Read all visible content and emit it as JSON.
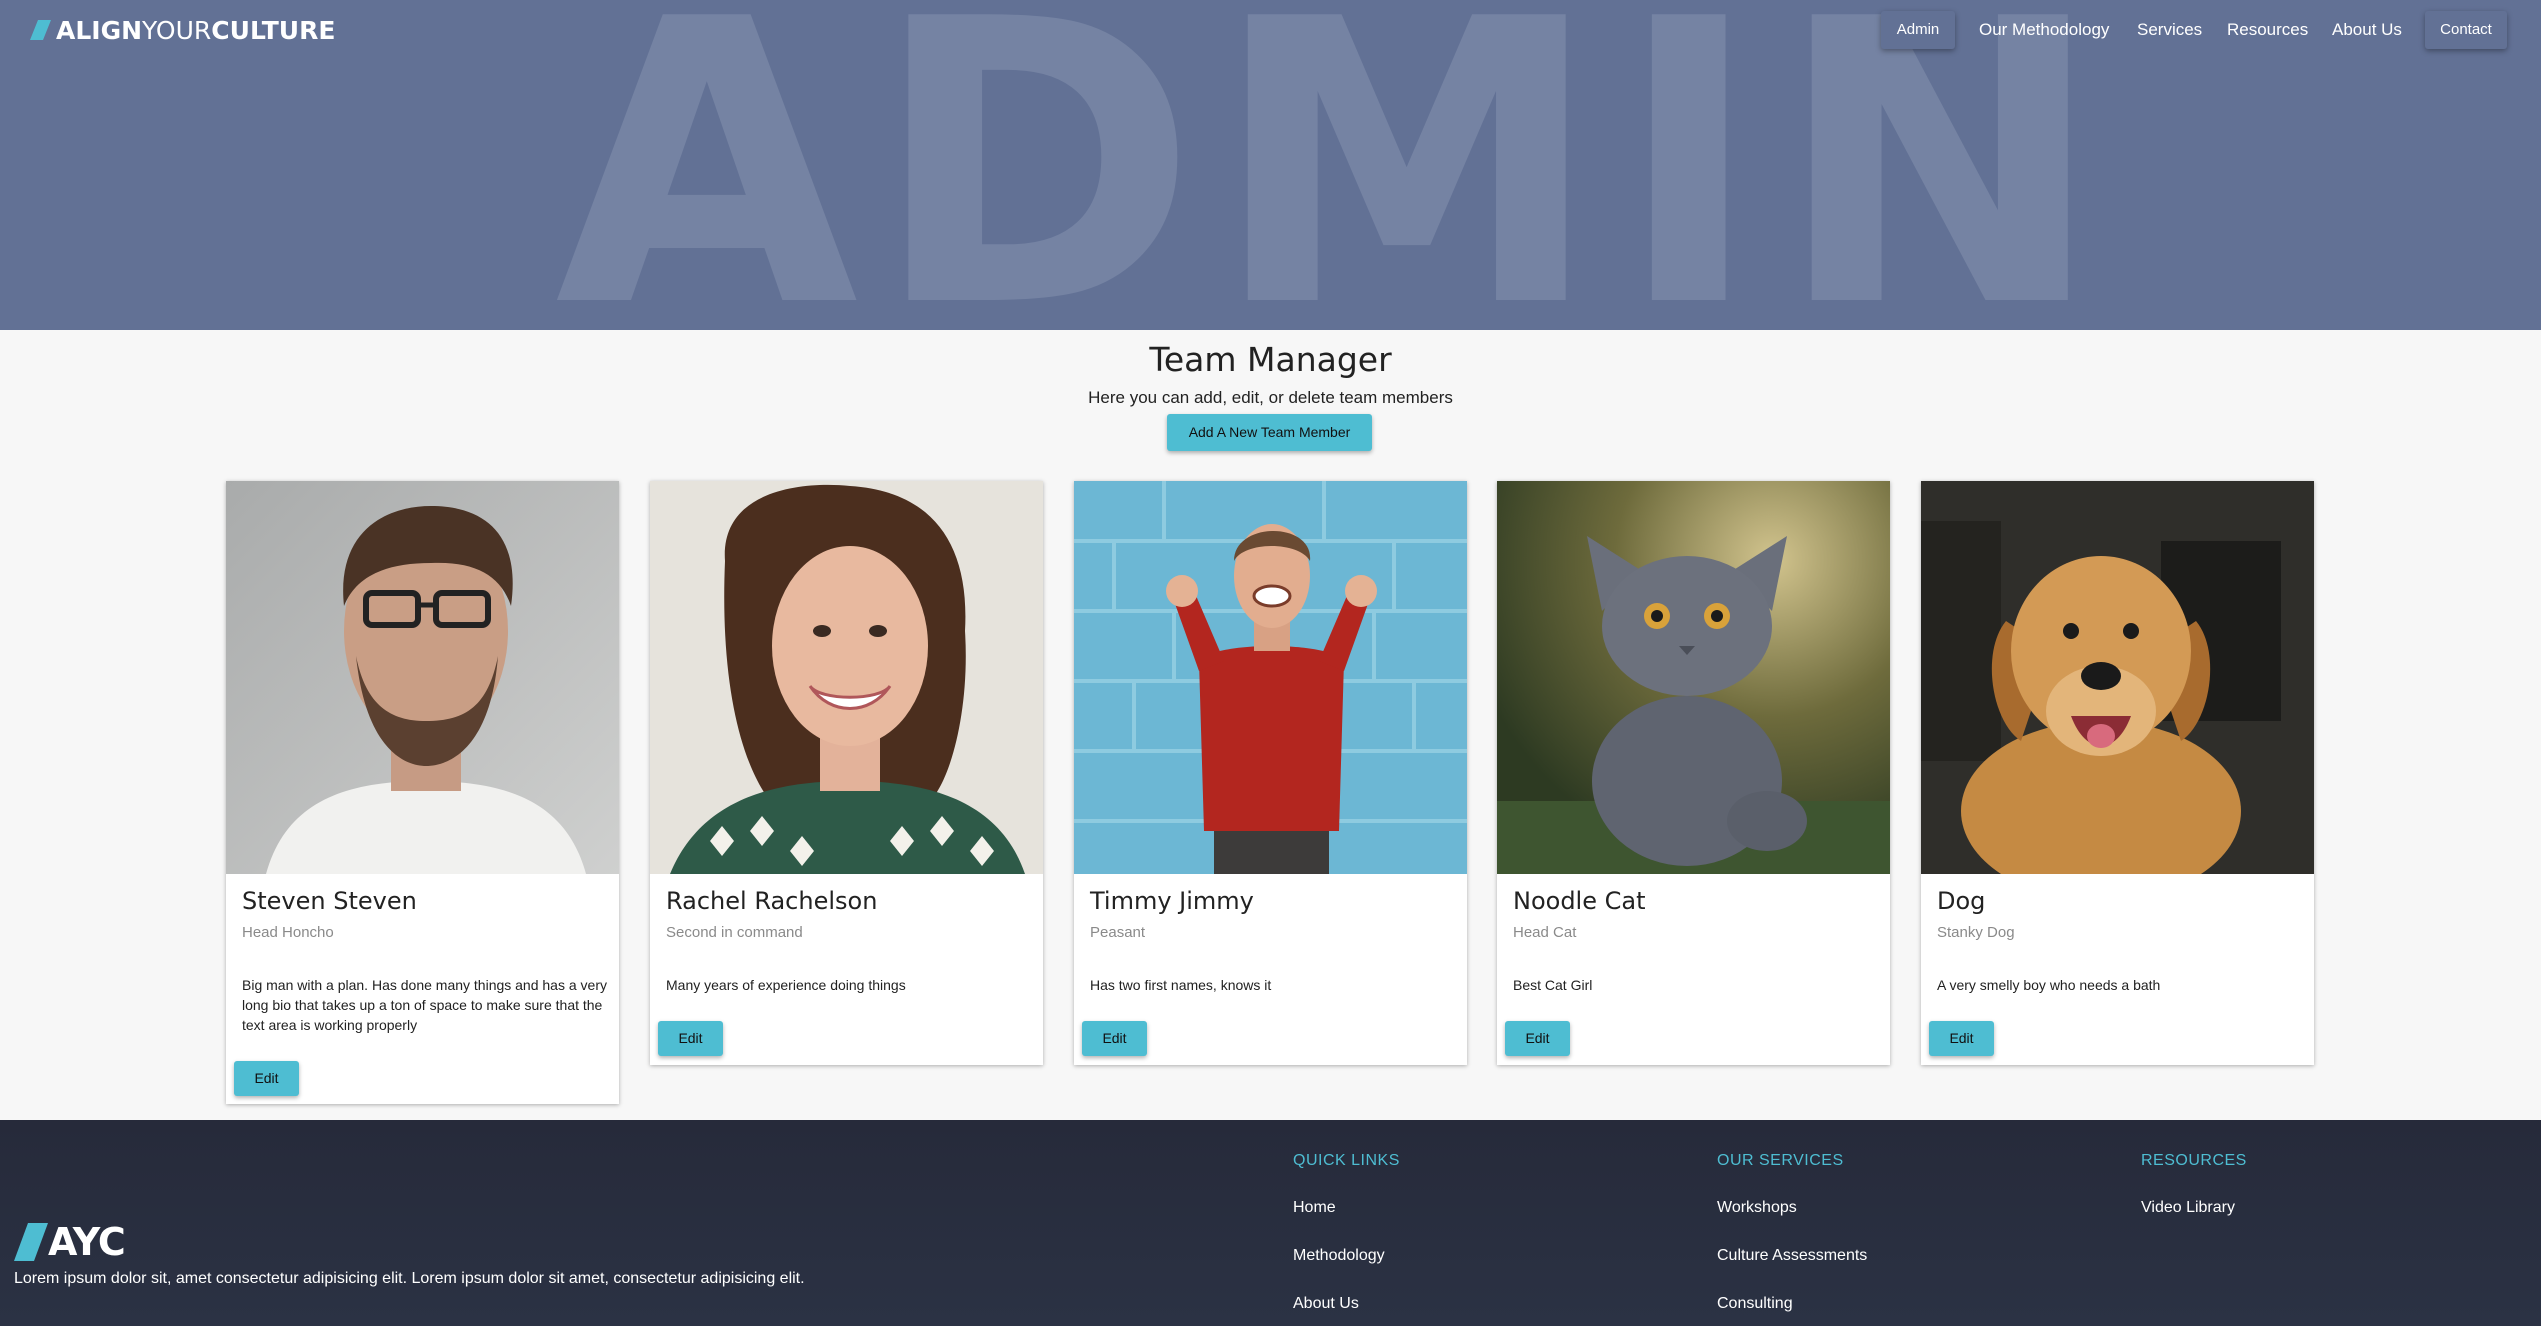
{
  "header": {
    "logo": {
      "part1": "ALIGN",
      "part2": "YOUR",
      "part3": "CULTURE"
    },
    "hero_word": "ADMIN",
    "nav": [
      {
        "label": "Admin"
      },
      {
        "label": "Our Methodology"
      },
      {
        "label": "Services"
      },
      {
        "label": "Resources"
      },
      {
        "label": "About Us"
      },
      {
        "label": "Contact"
      }
    ]
  },
  "main": {
    "title": "Team Manager",
    "subtitle": "Here you can add, edit, or delete team members",
    "add_button": "Add A New Team Member",
    "members": [
      {
        "name": "Steven Steven",
        "role": "Head Honcho",
        "bio": "Big man with a plan. Has done many things and has a very long bio that takes up a ton of space to make sure that the text area is working properly",
        "edit": "Edit"
      },
      {
        "name": "Rachel Rachelson",
        "role": "Second in command",
        "bio": "Many years of experience doing things",
        "edit": "Edit"
      },
      {
        "name": "Timmy Jimmy",
        "role": "Peasant",
        "bio": "Has two first names, knows it",
        "edit": "Edit"
      },
      {
        "name": "Noodle Cat",
        "role": "Head Cat",
        "bio": "Best Cat Girl",
        "edit": "Edit"
      },
      {
        "name": "Dog",
        "role": "Stanky Dog",
        "bio": "A very smelly boy who needs a bath",
        "edit": "Edit"
      }
    ]
  },
  "footer": {
    "logo_text": "AYC",
    "tagline": "Lorem ipsum dolor sit, amet consectetur adipisicing elit. Lorem ipsum dolor sit amet, consectetur adipisicing elit.",
    "quick_links": {
      "heading": "QUICK LINKS",
      "links": [
        "Home",
        "Methodology",
        "About Us"
      ]
    },
    "services": {
      "heading": "OUR SERVICES",
      "links": [
        "Workshops",
        "Culture Assessments",
        "Consulting"
      ]
    },
    "resources": {
      "heading": "RESOURCES",
      "links": [
        "Video Library"
      ]
    }
  },
  "colors": {
    "hero_bg": "#627195",
    "accent": "#4ebdd2",
    "footer_bg": "#262a3a"
  }
}
